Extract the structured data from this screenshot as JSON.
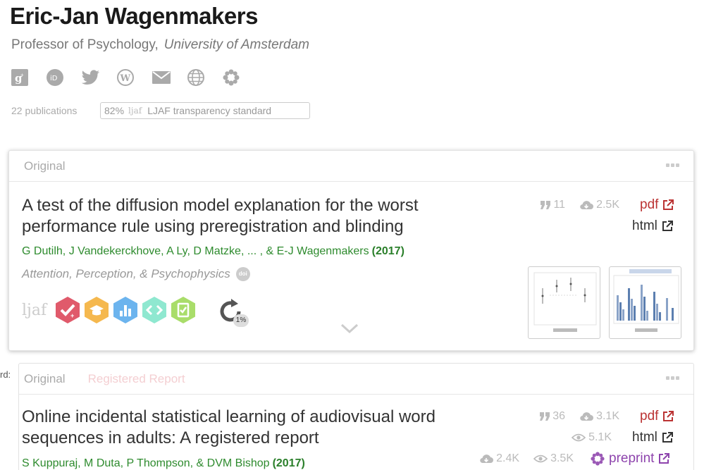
{
  "profile": {
    "name": "Eric-Jan Wagenmakers",
    "position": "Professor of Psychology,",
    "institution": "University of Amsterdam",
    "socials": [
      "google-scholar-icon",
      "orcid-icon",
      "twitter-icon",
      "wordpress-icon",
      "email-icon",
      "website-icon",
      "osf-icon"
    ],
    "pub_count": "22 publications",
    "transparency_pct": "82%",
    "transparency_logo": "ljaf",
    "transparency_label": "LJAF transparency standard"
  },
  "side_label": "rd:",
  "papers": [
    {
      "tag": "Original",
      "tag2": "",
      "title": "A test of the diffusion model explanation for the worst performance rule using preregistration and blinding",
      "authors": "G Dutilh, J Vandekerckhove, A Ly, D Matzke, ... , & E-J Wagenmakers",
      "year": "(2017)",
      "journal": "Attention, Perception, & Psychophysics",
      "doi": "doi",
      "ljaf": "ljaf",
      "replication_pct": "1%",
      "citations": "11",
      "downloads": "2.5K",
      "links": {
        "pdf": "pdf",
        "html": "html"
      }
    },
    {
      "tag": "Original",
      "tag2": "Registered Report",
      "title": "Online incidental statistical learning of audiovisual word sequences in adults: A registered report",
      "authors": "S Kuppuraj, M Duta, P Thompson, & DVM Bishop",
      "year": "(2017)",
      "citations": "36",
      "downloads": "3.1K",
      "html_views": "5.1K",
      "preprint_downloads": "2.4K",
      "preprint_views": "3.5K",
      "links": {
        "pdf": "pdf",
        "html": "html",
        "preprint": "preprint"
      }
    }
  ],
  "colors": {
    "author_green": "#2e8b2e",
    "pdf_red": "#b33333",
    "preprint_purple": "#8e44ad",
    "badge_prereg": "#e05a6b",
    "badge_openmat": "#f5b84e",
    "badge_data": "#6cb4ee",
    "badge_code": "#8fe8d0",
    "badge_report": "#a9dd6a"
  }
}
